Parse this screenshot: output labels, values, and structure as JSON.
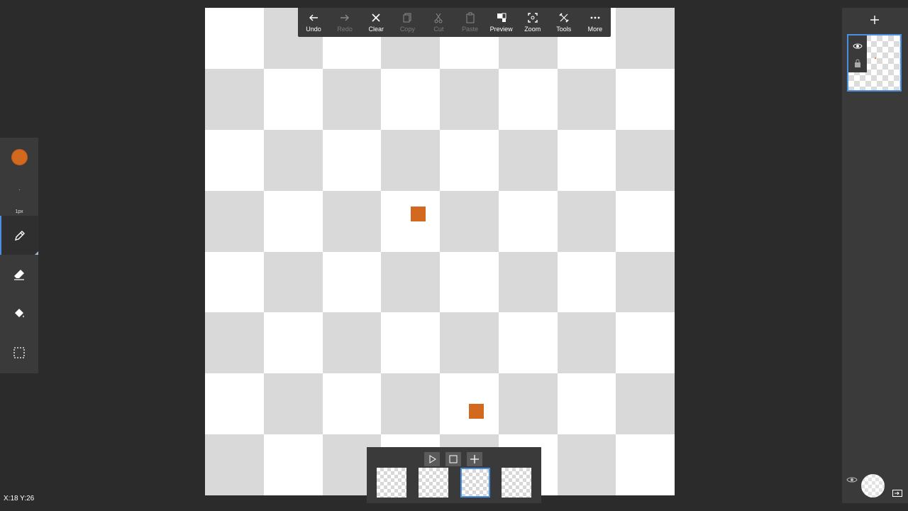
{
  "toolbar": {
    "undo": "Undo",
    "redo": "Redo",
    "clear": "Clear",
    "copy": "Copy",
    "cut": "Cut",
    "paste": "Paste",
    "preview": "Preview",
    "zoom": "Zoom",
    "tools": "Tools",
    "more": "More"
  },
  "left_toolbar": {
    "brush_size": "1px",
    "primary_color": "#d2691e",
    "active_tool": "pencil"
  },
  "status": {
    "coords": "X:18 Y:26"
  },
  "colors": {
    "accent": "#4a90e2",
    "panel": "#3a3a3a",
    "background": "#2b2b2b",
    "paint": "#d2691e"
  },
  "animation": {
    "selected_frame_index": 3
  }
}
